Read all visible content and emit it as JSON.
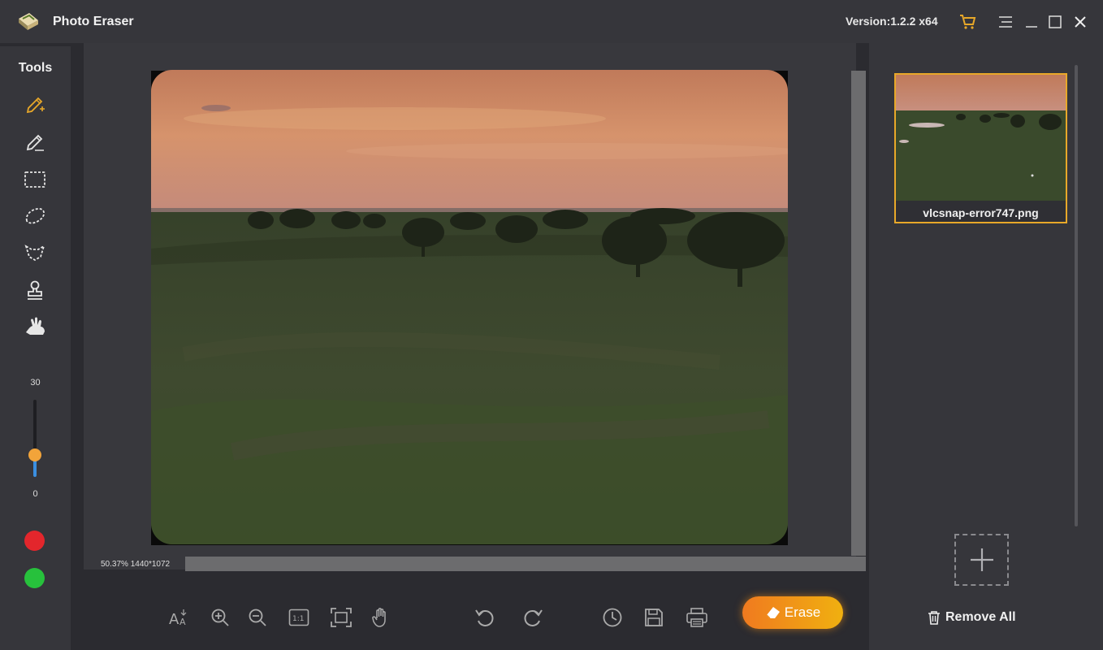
{
  "app": {
    "title": "Photo Eraser",
    "version": "Version:1.2.2 x64"
  },
  "titlebar_icons": [
    "cart-icon",
    "menu-icon",
    "minimize-icon",
    "maximize-icon",
    "close-icon"
  ],
  "tools": {
    "title": "Tools",
    "items": [
      "smart-brush-icon",
      "pencil-icon",
      "rectangle-select-icon",
      "lasso-icon",
      "polygon-lasso-icon",
      "clone-stamp-icon",
      "restore-hand-icon"
    ],
    "brush_size": {
      "max_label": "30",
      "min_label": "0"
    },
    "colors": {
      "red": "#e3262c",
      "green": "#27c13c"
    }
  },
  "canvas": {
    "zoom_info": "50.37% 1440*1072"
  },
  "bottom_toolbar": {
    "erase_label": "Erase",
    "icons": [
      "text-size-icon",
      "zoom-in-icon",
      "zoom-out-icon",
      "actual-size-icon",
      "fit-screen-icon",
      "pan-hand-icon",
      "undo-icon",
      "redo-icon",
      "history-icon",
      "save-icon",
      "print-icon"
    ]
  },
  "right_panel": {
    "files": [
      {
        "name": "vlcsnap-error747.png"
      }
    ],
    "remove_all_label": "Remove All"
  },
  "colors": {
    "accent": "#e8a829",
    "erase_gradient_start": "#f07a1f",
    "erase_gradient_end": "#f0b010"
  }
}
